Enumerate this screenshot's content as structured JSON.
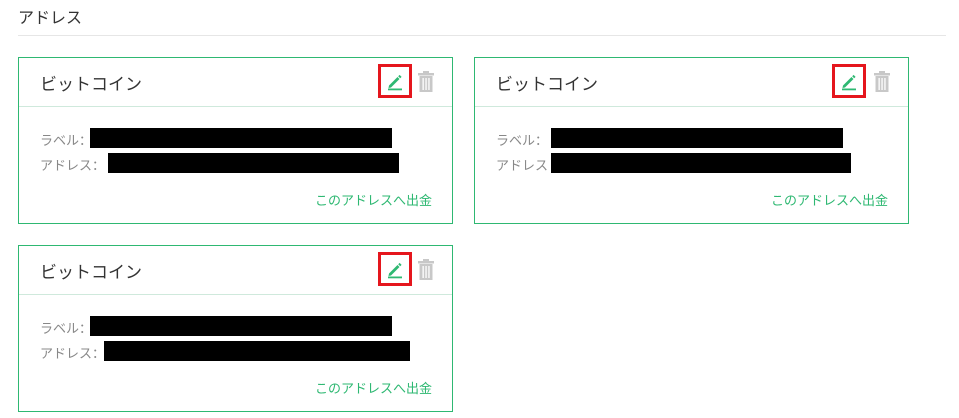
{
  "section": {
    "title": "アドレス"
  },
  "cards": [
    {
      "title": "ビットコイン",
      "label_caption": "ラベル：",
      "address_caption": "アドレス：",
      "withdraw_link": "このアドレスへ出金",
      "edit_icon": "pencil-icon",
      "delete_icon": "trash-icon"
    },
    {
      "title": "ビットコイン",
      "label_caption": "ラベル：",
      "address_caption": "アドレス",
      "withdraw_link": "このアドレスへ出金",
      "edit_icon": "pencil-icon",
      "delete_icon": "trash-icon"
    },
    {
      "title": "ビットコイン",
      "label_caption": "ラベル：",
      "address_caption": "アドレス：",
      "withdraw_link": "このアドレスへ出金",
      "edit_icon": "pencil-icon",
      "delete_icon": "trash-icon"
    }
  ],
  "colors": {
    "accent": "#2eb872",
    "highlight_border": "#e5161d",
    "redaction": "#000000",
    "muted_icon": "#c8c8c8"
  }
}
